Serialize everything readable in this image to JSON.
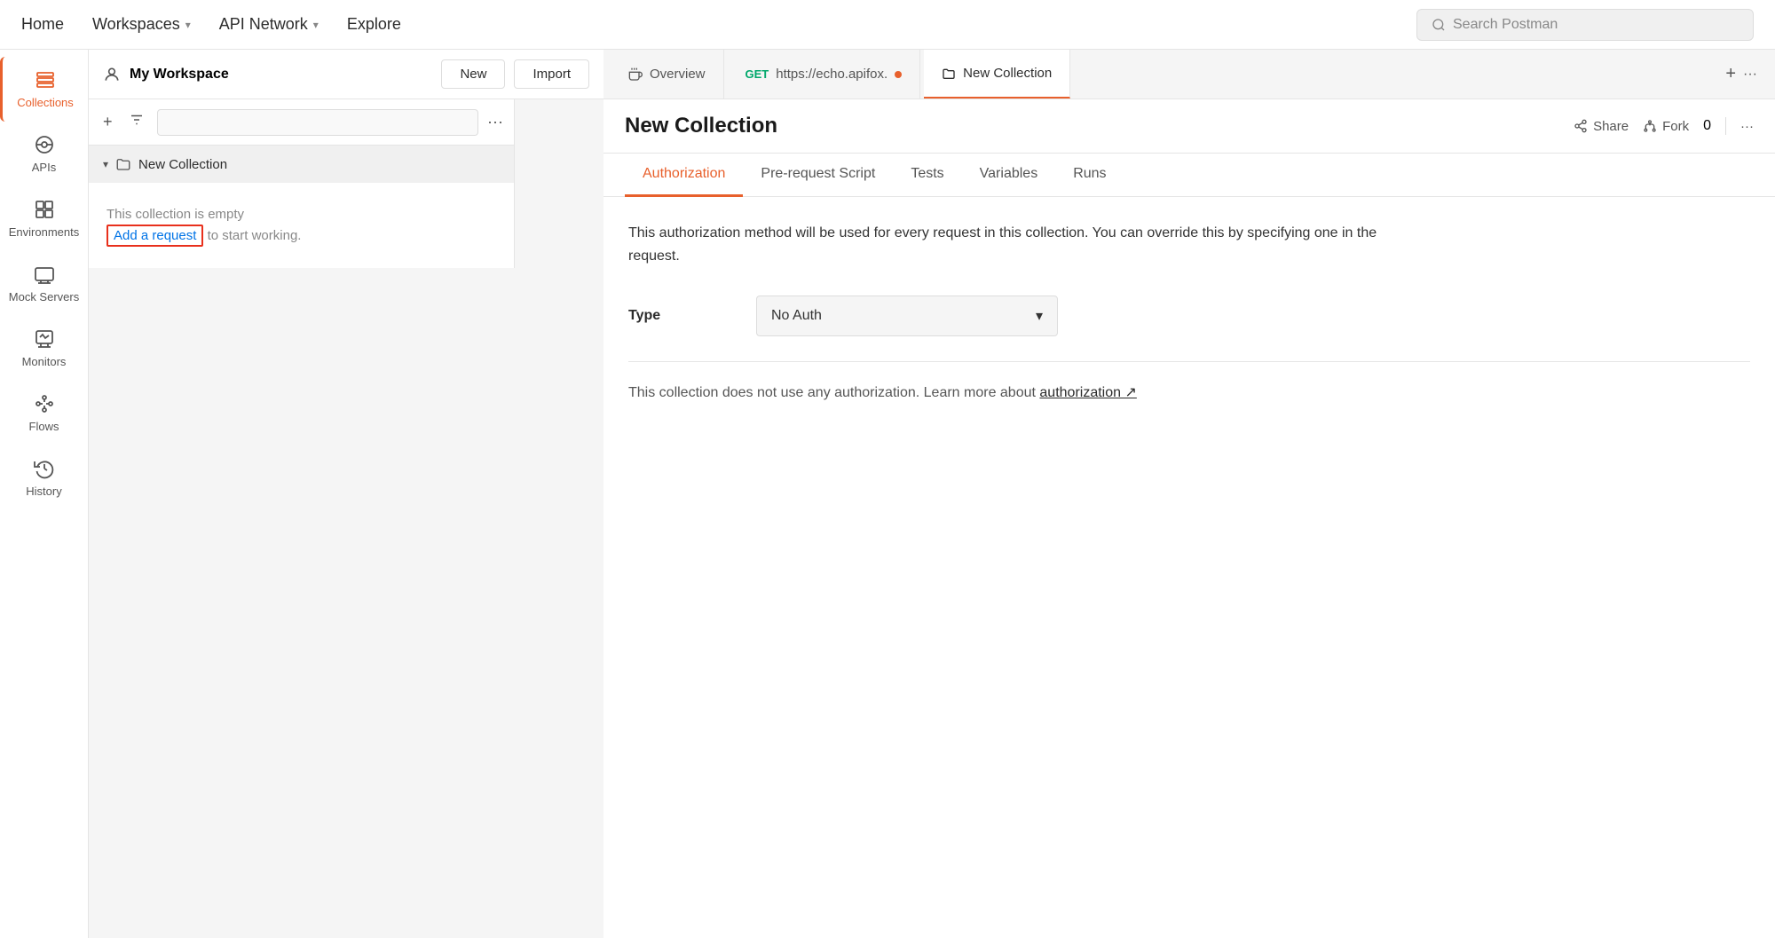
{
  "topNav": {
    "home": "Home",
    "workspaces": "Workspaces",
    "apiNetwork": "API Network",
    "explore": "Explore",
    "searchPlaceholder": "Search Postman"
  },
  "workspace": {
    "name": "My Workspace",
    "newLabel": "New",
    "importLabel": "Import"
  },
  "sidebar": {
    "items": [
      {
        "id": "collections",
        "label": "Collections",
        "active": true
      },
      {
        "id": "apis",
        "label": "APIs",
        "active": false
      },
      {
        "id": "environments",
        "label": "Environments",
        "active": false
      },
      {
        "id": "mock-servers",
        "label": "Mock Servers",
        "active": false
      },
      {
        "id": "monitors",
        "label": "Monitors",
        "active": false
      },
      {
        "id": "flows",
        "label": "Flows",
        "active": false
      },
      {
        "id": "history",
        "label": "History",
        "active": false
      }
    ]
  },
  "collectionsPanel": {
    "moreLabel": "···",
    "collectionName": "New Collection",
    "emptyText": "This collection is empty",
    "addRequestLabel": "Add a request",
    "afterText": "to start working."
  },
  "tabs": [
    {
      "id": "overview",
      "label": "Overview",
      "type": "overview"
    },
    {
      "id": "get-request",
      "label": "https://echo.apifox.",
      "badge": "GET",
      "hasDot": true,
      "type": "request"
    },
    {
      "id": "new-collection",
      "label": "New Collection",
      "type": "collection",
      "active": true
    }
  ],
  "tabActions": {
    "addLabel": "+",
    "moreLabel": "···"
  },
  "content": {
    "title": "New Collection",
    "shareLabel": "Share",
    "forkLabel": "Fork",
    "forkCount": "0",
    "moreLabel": "···"
  },
  "subTabs": [
    {
      "id": "authorization",
      "label": "Authorization",
      "active": true
    },
    {
      "id": "pre-request-script",
      "label": "Pre-request Script",
      "active": false
    },
    {
      "id": "tests",
      "label": "Tests",
      "active": false
    },
    {
      "id": "variables",
      "label": "Variables",
      "active": false
    },
    {
      "id": "runs",
      "label": "Runs",
      "active": false
    }
  ],
  "authorization": {
    "description": "This authorization method will be used for every request in this collection. You can override this by specifying one in the request.",
    "typeLabel": "Type",
    "typeValue": "No Auth",
    "noAuthMessage": "This collection does not use any authorization. Learn more about",
    "noAuthLink": "authorization ↗"
  }
}
